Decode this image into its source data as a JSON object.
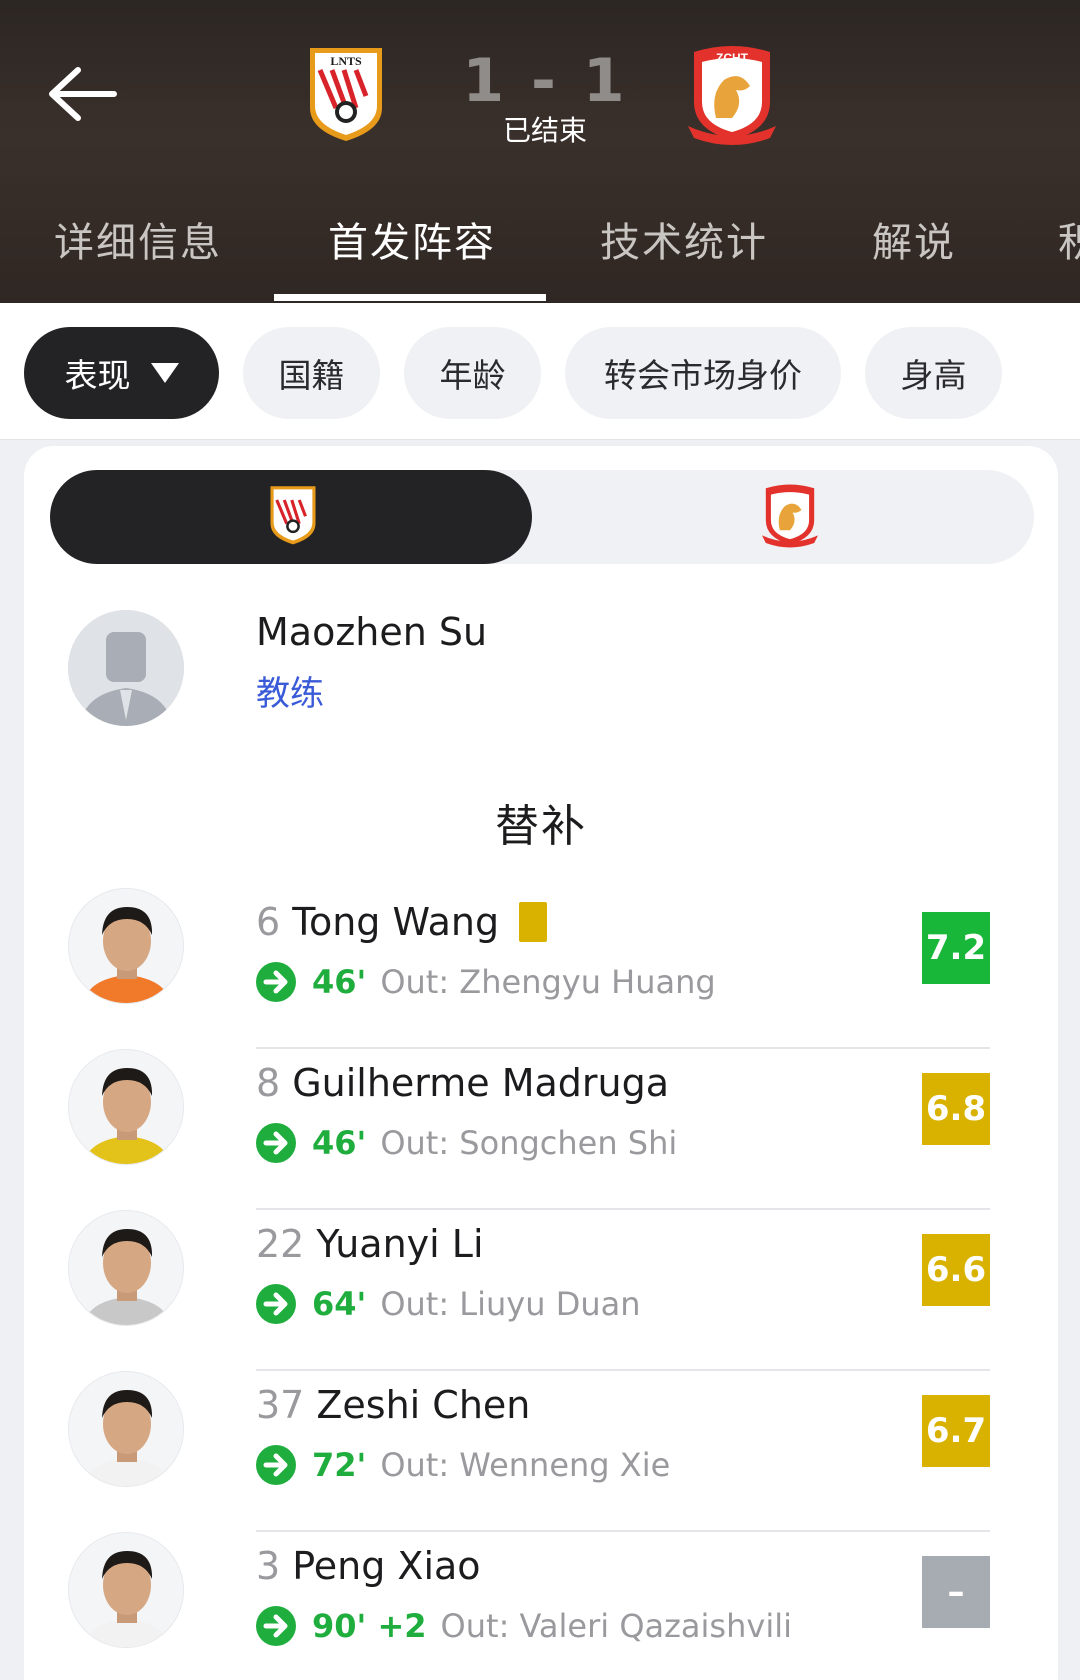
{
  "header": {
    "score": "1 - 1",
    "status": "已结束",
    "home_crest_text": "LNTS",
    "away_crest_text": "ZCHT"
  },
  "tabs": [
    {
      "label": "详细信息",
      "active": false
    },
    {
      "label": "首发阵容",
      "active": true
    },
    {
      "label": "技术统计",
      "active": false
    },
    {
      "label": "解说",
      "active": false
    },
    {
      "label": "积",
      "active": false
    }
  ],
  "filters": [
    {
      "label": "表现",
      "active": true
    },
    {
      "label": "国籍",
      "active": false
    },
    {
      "label": "年龄",
      "active": false
    },
    {
      "label": "转会市场身价",
      "active": false
    },
    {
      "label": "身高",
      "active": false
    }
  ],
  "coach": {
    "name": "Maozhen Su",
    "role": "教练"
  },
  "section_title": "替补",
  "colors": {
    "green": "#1fae3e",
    "rating_high": "#18b73a",
    "rating_mid": "#d9b200",
    "rating_none": "#a7abb2",
    "link_blue": "#3a5bd8"
  },
  "players": [
    {
      "number": "6",
      "name": "Tong Wang",
      "yellow_card": true,
      "minute": "46'",
      "added": "",
      "out": "Out: Zhengyu Huang",
      "rating": "7.2",
      "rating_color": "#18b73a",
      "kit": "#f07a2a"
    },
    {
      "number": "8",
      "name": "Guilherme Madruga",
      "yellow_card": false,
      "minute": "46'",
      "added": "",
      "out": "Out: Songchen Shi",
      "rating": "6.8",
      "rating_color": "#d9b200",
      "kit": "#e3c21a"
    },
    {
      "number": "22",
      "name": "Yuanyi Li",
      "yellow_card": false,
      "minute": "64'",
      "added": "",
      "out": "Out: Liuyu Duan",
      "rating": "6.6",
      "rating_color": "#d9b200",
      "kit": "#c8c8c8"
    },
    {
      "number": "37",
      "name": "Zeshi Chen",
      "yellow_card": false,
      "minute": "72'",
      "added": "",
      "out": "Out: Wenneng Xie",
      "rating": "6.7",
      "rating_color": "#d9b200",
      "kit": "#f2f2f2"
    },
    {
      "number": "3",
      "name": "Peng Xiao",
      "yellow_card": false,
      "minute": "90'",
      "added": "+2",
      "out": "Out: Valeri Qazaishvili",
      "rating": "–",
      "rating_color": "#a7abb2",
      "kit": "#f2f2f2"
    }
  ]
}
